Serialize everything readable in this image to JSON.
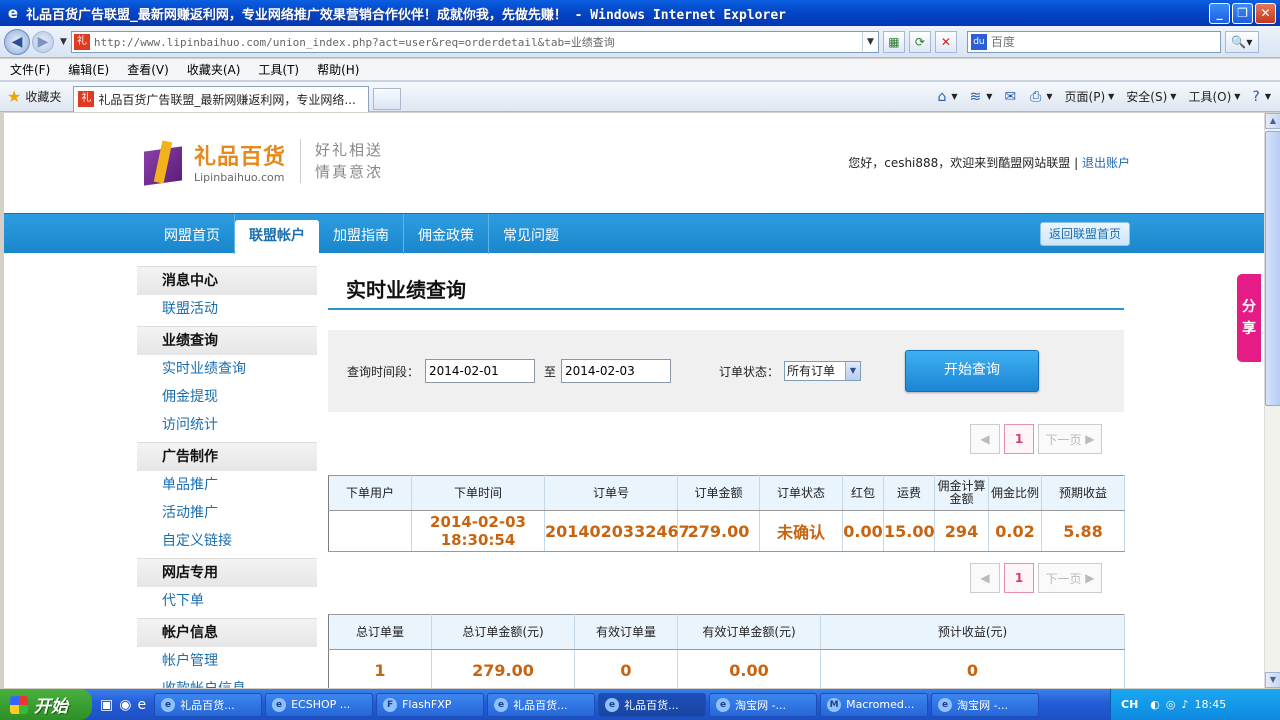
{
  "window": {
    "title": "礼品百货广告联盟_最新网赚返利网，专业网络推广效果营销合作伙伴！成就你我，先做先赚！ - Windows Internet Explorer"
  },
  "address": {
    "url": "http://www.lipinbaihuo.com/union_index.php?act=user&req=orderdetail&tab=业绩查询"
  },
  "search": {
    "placeholder": "百度"
  },
  "menu": [
    "文件(F)",
    "编辑(E)",
    "查看(V)",
    "收藏夹(A)",
    "工具(T)",
    "帮助(H)"
  ],
  "favorites": {
    "label": "收藏夹"
  },
  "tab": {
    "label": "礼品百货广告联盟_最新网赚返利网，专业网络..."
  },
  "commandbar": {
    "page": "页面(P)",
    "safety": "安全(S)",
    "tools": "工具(O)"
  },
  "site": {
    "logo_cn": "礼品百货",
    "logo_en": "Lipinbaihuo.com",
    "slogan_1": "好礼相送",
    "slogan_2": "情真意浓",
    "welcome": "您好，ceshi888，欢迎来到酷盟网站联盟 |",
    "logout": "退出账户"
  },
  "nav": {
    "items": [
      "网盟首页",
      "联盟帐户",
      "加盟指南",
      "佣金政策",
      "常见问题"
    ],
    "back_home": "返回联盟首页"
  },
  "sidebar": {
    "groups": [
      {
        "title": "消息中心",
        "items": [
          "联盟活动"
        ]
      },
      {
        "title": "业绩查询",
        "items": [
          "实时业绩查询",
          "佣金提现",
          "访问统计"
        ]
      },
      {
        "title": "广告制作",
        "items": [
          "单品推广",
          "活动推广",
          "自定义链接"
        ]
      },
      {
        "title": "网店专用",
        "items": [
          "代下单"
        ]
      },
      {
        "title": "帐户信息",
        "items": [
          "帐户管理",
          "收款帐户信息"
        ]
      }
    ]
  },
  "main": {
    "title": "实时业绩查询",
    "query": {
      "period_label": "查询时间段：",
      "start_date": "2014-02-01",
      "to_label": "至",
      "end_date": "2014-02-03",
      "status_label": "订单状态：",
      "status_value": "所有订单",
      "button": "开始查询"
    },
    "pager": {
      "current": "1",
      "next": "下一页"
    },
    "orders": {
      "headers": [
        "下单用户",
        "下单时间",
        "订单号",
        "订单金额",
        "订单状态",
        "红包",
        "运费",
        "佣金计算金额",
        "佣金比例",
        "预期收益"
      ],
      "rows": [
        [
          "",
          "2014-02-03 18:30:54",
          "2014020332467",
          "279.00",
          "未确认",
          "0.00",
          "15.00",
          "294",
          "0.02",
          "5.88"
        ]
      ]
    },
    "summary": {
      "headers": [
        "总订单量",
        "总订单金额(元)",
        "有效订单量",
        "有效订单金额(元)",
        "预计收益(元)"
      ],
      "values": [
        "1",
        "279.00",
        "0",
        "0.00",
        "0"
      ]
    }
  },
  "share": {
    "label_1": "分",
    "label_2": "享"
  },
  "taskbar": {
    "start": "开始",
    "tasks": [
      "礼品百货...",
      "ECSHOP ...",
      "FlashFXP",
      "礼品百货...",
      "礼品百货...",
      "淘宝网 -...",
      "Macromed...",
      "淘宝网 -..."
    ],
    "lang": "CH",
    "clock": "18:45"
  },
  "colors": {
    "nav_blue": "#1a86cc",
    "value_orange": "#c86410",
    "link_blue": "#1a6fb0",
    "share_pink": "#e51c85"
  }
}
